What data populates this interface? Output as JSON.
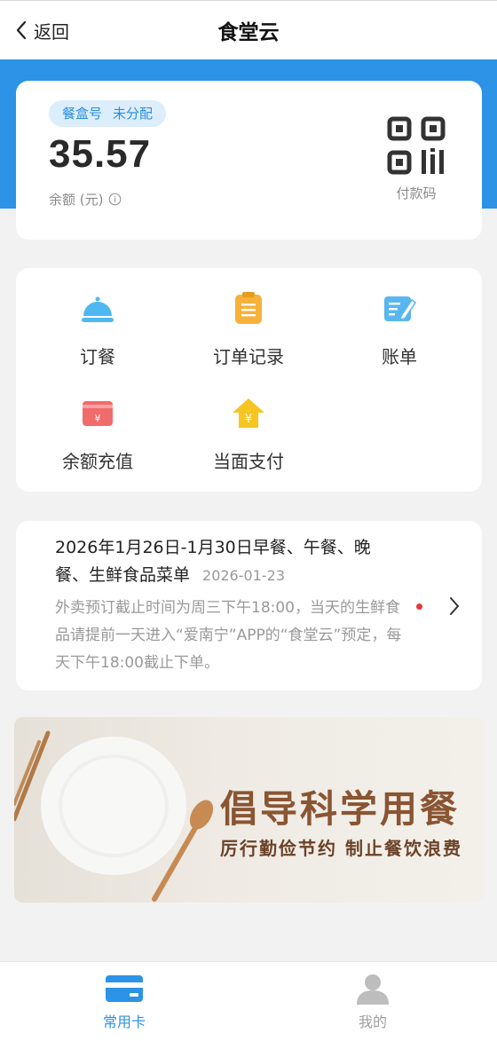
{
  "header": {
    "back_label": "返回",
    "title": "食堂云"
  },
  "balance_card": {
    "badge_label": "餐盒号",
    "badge_value": "未分配",
    "amount": "35.57",
    "amount_label": "余额 (元)",
    "qr_label": "付款码"
  },
  "menu": {
    "items": [
      {
        "label": "订餐",
        "icon": "cloche-icon"
      },
      {
        "label": "订单记录",
        "icon": "clipboard-icon"
      },
      {
        "label": "账单",
        "icon": "bill-edit-icon"
      },
      {
        "label": "余额充值",
        "icon": "recharge-card-icon"
      },
      {
        "label": "当面支付",
        "icon": "house-yuan-icon"
      }
    ]
  },
  "notice": {
    "title": "2026年1月26日-1月30日早餐、午餐、晚餐、生鲜食品菜单",
    "date": "2026-01-23",
    "body": "外卖预订截止时间为周三下午18:00，当天的生鲜食品请提前一天进入“爱南宁”APP的“食堂云”预定，每天下午18:00截止下单。"
  },
  "banner": {
    "title": "倡导科学用餐",
    "subtitle": "厉行勤俭节约 制止餐饮浪费"
  },
  "tabbar": {
    "tabs": [
      {
        "label": "常用卡",
        "active": true,
        "icon": "card-icon"
      },
      {
        "label": "我的",
        "active": false,
        "icon": "person-icon"
      }
    ]
  },
  "colors": {
    "brand_blue": "#2c93e6",
    "active_tab": "#2c93e6",
    "inactive_tab": "#9e9e9e"
  }
}
